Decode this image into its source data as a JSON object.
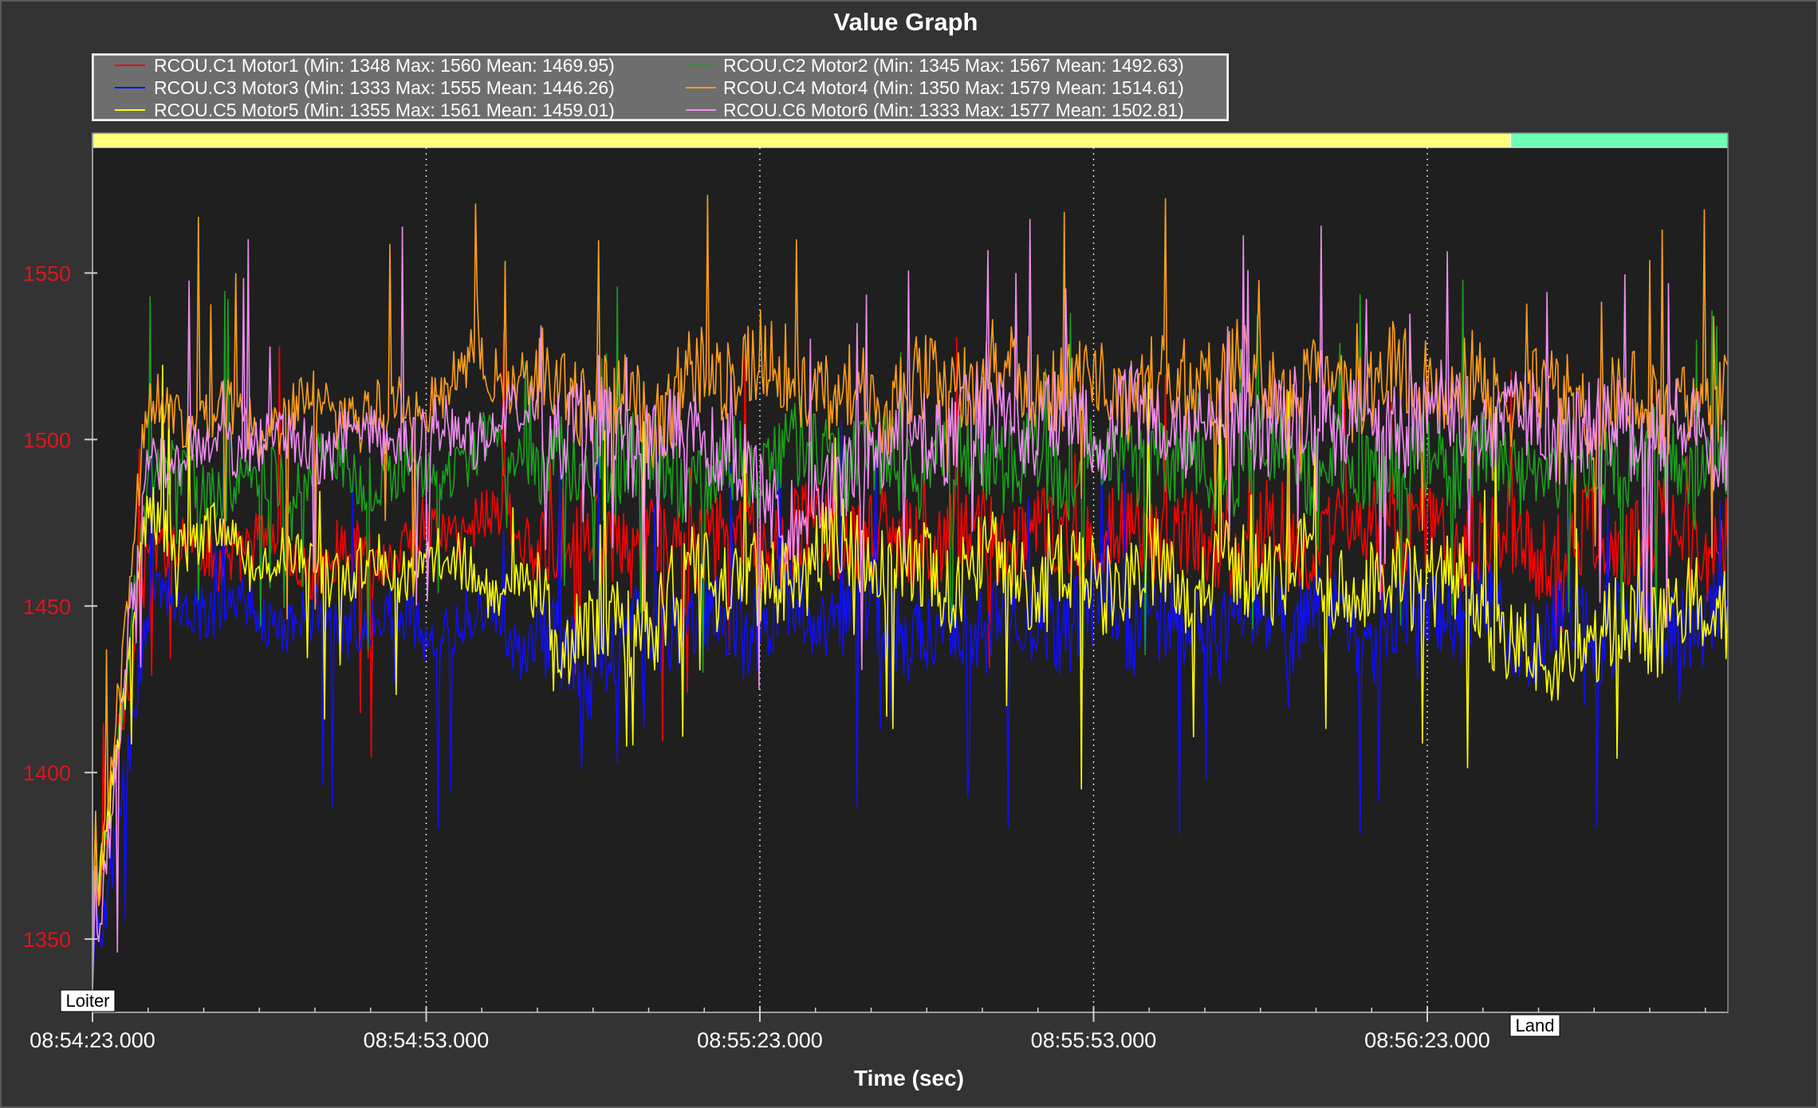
{
  "chart_data": {
    "type": "line",
    "title": "Value Graph",
    "xlabel": "Time (sec)",
    "ylabel": "",
    "x_range_sec": [
      0,
      137
    ],
    "ylim": [
      1328,
      1592
    ],
    "yticks": [
      1350,
      1400,
      1450,
      1500,
      1550
    ],
    "ytick_color": "#e0161b",
    "xticks": [
      {
        "t": 0,
        "label": "08:54:23.000"
      },
      {
        "t": 30,
        "label": "08:54:53.000"
      },
      {
        "t": 60,
        "label": "08:55:23.000"
      },
      {
        "t": 90,
        "label": "08:55:53.000"
      },
      {
        "t": 120,
        "label": "08:56:23.000"
      }
    ],
    "grid": "vertical dotted at major ticks",
    "legend_position": "top-left",
    "plot_background": "#1f1f1f",
    "modes": [
      {
        "label": "Loiter",
        "start": 0,
        "end": 127.5,
        "color": "#ffff7a"
      },
      {
        "label": "Land",
        "start": 127.5,
        "end": 147.5,
        "color": "#6effb4"
      }
    ],
    "series": [
      {
        "name": "RCOU.C1 Motor1",
        "legend": "RCOU.C1 Motor1 (Min: 1348 Max: 1560 Mean: 1469.95)",
        "color": "#ff0000",
        "min": 1348,
        "max": 1560,
        "mean": 1469.95,
        "x": [
          0,
          5,
          10,
          15,
          20,
          25,
          30,
          35,
          40,
          45,
          50,
          55,
          60,
          65,
          70,
          75,
          80,
          85,
          90,
          95,
          100,
          105,
          110,
          115,
          120,
          125,
          130,
          135,
          140,
          145,
          147
        ],
        "values": [
          1348,
          1470,
          1465,
          1468,
          1462,
          1466,
          1470,
          1478,
          1468,
          1472,
          1465,
          1470,
          1468,
          1472,
          1470,
          1468,
          1472,
          1470,
          1470,
          1474,
          1468,
          1472,
          1470,
          1474,
          1470,
          1472,
          1468,
          1470,
          1472,
          1468,
          1470
        ]
      },
      {
        "name": "RCOU.C2 Motor2",
        "legend": "RCOU.C2 Motor2 (Min: 1345 Max: 1567 Mean: 1492.63)",
        "color": "#1aa01a",
        "min": 1345,
        "max": 1567,
        "mean": 1492.63,
        "x": [
          0,
          5,
          10,
          15,
          20,
          25,
          30,
          35,
          40,
          45,
          50,
          55,
          60,
          65,
          70,
          75,
          80,
          85,
          90,
          95,
          100,
          105,
          110,
          115,
          120,
          125,
          130,
          135,
          140,
          145,
          147
        ],
        "values": [
          1345,
          1490,
          1486,
          1488,
          1492,
          1490,
          1488,
          1496,
          1494,
          1490,
          1492,
          1488,
          1494,
          1496,
          1492,
          1494,
          1496,
          1490,
          1492,
          1494,
          1490,
          1496,
          1492,
          1494,
          1492,
          1496,
          1490,
          1494,
          1492,
          1490,
          1492
        ]
      },
      {
        "name": "RCOU.C3 Motor3",
        "legend": "RCOU.C3 Motor3 (Min: 1333 Max: 1555 Mean: 1446.26)",
        "color": "#1010ff",
        "min": 1333,
        "max": 1555,
        "mean": 1446.26,
        "x": [
          0,
          5,
          10,
          15,
          20,
          25,
          30,
          35,
          40,
          45,
          50,
          55,
          60,
          65,
          70,
          75,
          80,
          85,
          90,
          95,
          100,
          105,
          110,
          115,
          120,
          125,
          130,
          135,
          140,
          145,
          147
        ],
        "values": [
          1333,
          1450,
          1452,
          1448,
          1444,
          1446,
          1444,
          1446,
          1438,
          1432,
          1442,
          1446,
          1446,
          1450,
          1448,
          1442,
          1446,
          1444,
          1448,
          1446,
          1442,
          1448,
          1446,
          1444,
          1450,
          1446,
          1440,
          1444,
          1446,
          1444,
          1446
        ]
      },
      {
        "name": "RCOU.C4 Motor4",
        "legend": "RCOU.C4 Motor4 (Min: 1350 Max: 1579 Mean: 1514.61)",
        "color": "#ff9e1a",
        "min": 1350,
        "max": 1579,
        "mean": 1514.61,
        "x": [
          0,
          5,
          10,
          15,
          20,
          25,
          30,
          35,
          40,
          45,
          50,
          55,
          60,
          65,
          70,
          75,
          80,
          85,
          90,
          95,
          100,
          105,
          110,
          115,
          120,
          125,
          130,
          135,
          140,
          145,
          147
        ],
        "values": [
          1350,
          1510,
          1508,
          1505,
          1510,
          1506,
          1512,
          1524,
          1516,
          1512,
          1508,
          1518,
          1524,
          1514,
          1512,
          1516,
          1522,
          1518,
          1516,
          1514,
          1520,
          1518,
          1514,
          1516,
          1520,
          1514,
          1512,
          1510,
          1512,
          1510,
          1512
        ]
      },
      {
        "name": "RCOU.C5 Motor5",
        "legend": "RCOU.C5 Motor5 (Min: 1355 Max: 1561 Mean: 1459.01)",
        "color": "#ffff00",
        "min": 1355,
        "max": 1561,
        "mean": 1459.01,
        "x": [
          0,
          5,
          10,
          15,
          20,
          25,
          30,
          35,
          40,
          45,
          50,
          55,
          60,
          65,
          70,
          75,
          80,
          85,
          90,
          95,
          100,
          105,
          110,
          115,
          120,
          125,
          130,
          135,
          140,
          145,
          147
        ],
        "values": [
          1355,
          1476,
          1470,
          1466,
          1462,
          1460,
          1464,
          1460,
          1450,
          1440,
          1446,
          1460,
          1454,
          1466,
          1468,
          1458,
          1462,
          1458,
          1458,
          1460,
          1456,
          1462,
          1460,
          1456,
          1460,
          1452,
          1430,
          1440,
          1446,
          1448,
          1452
        ]
      },
      {
        "name": "RCOU.C6 Motor6",
        "legend": "RCOU.C6 Motor6 (Min: 1333 Max: 1577 Mean: 1502.81)",
        "color": "#f08cf0",
        "min": 1333,
        "max": 1577,
        "mean": 1502.81,
        "x": [
          0,
          5,
          10,
          15,
          20,
          25,
          30,
          35,
          40,
          45,
          50,
          55,
          60,
          65,
          70,
          75,
          80,
          85,
          90,
          95,
          100,
          105,
          110,
          115,
          120,
          125,
          130,
          135,
          140,
          145,
          147
        ],
        "values": [
          1333,
          1495,
          1497,
          1500,
          1498,
          1502,
          1500,
          1504,
          1506,
          1502,
          1500,
          1506,
          1482,
          1478,
          1496,
          1502,
          1506,
          1504,
          1504,
          1506,
          1502,
          1504,
          1506,
          1504,
          1508,
          1506,
          1504,
          1502,
          1504,
          1500,
          1502
        ]
      }
    ]
  }
}
